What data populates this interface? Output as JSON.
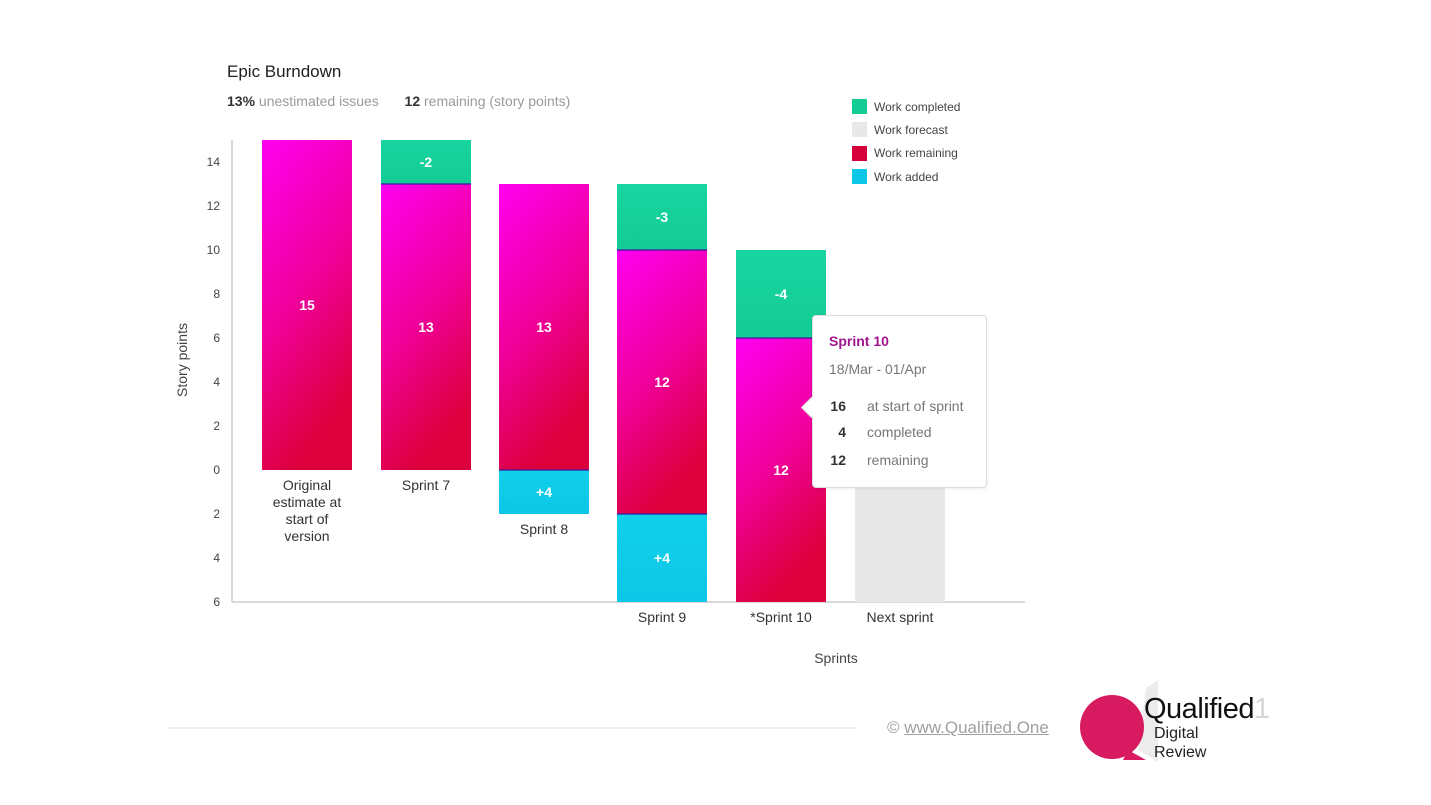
{
  "header": {
    "title": "Epic Burndown",
    "unestimated_pct": "13%",
    "unestimated_label": "unestimated issues",
    "remaining_value": "12",
    "remaining_label": "remaining (story points)"
  },
  "legend": [
    {
      "label": "Work completed",
      "color": "#14cc94"
    },
    {
      "label": "Work forecast",
      "color": "#e8e8e8"
    },
    {
      "label": "Work remaining",
      "color": "#d6003a"
    },
    {
      "label": "Work added",
      "color": "#0ec6e6"
    }
  ],
  "tooltip": {
    "title": "Sprint 10",
    "dates": "18/Mar - 01/Apr",
    "rows": [
      {
        "value": "16",
        "label": "at start of sprint"
      },
      {
        "value": "4",
        "label": "completed"
      },
      {
        "value": "12",
        "label": "remaining"
      }
    ]
  },
  "footer": {
    "copyright_symbol": "©",
    "copyright_link": "www.Qualified.One",
    "logo_main": "Qualified",
    "logo_one": "1",
    "logo_line2": "Digital",
    "logo_line3": "Review"
  },
  "colors": {
    "completed": "#14cc94",
    "forecast": "#e8e8e8",
    "remaining_top": "#ff00f0",
    "remaining_bottom": "#dc003c",
    "added": "#0ec6e6",
    "tooltip_title": "#a0158f",
    "logo_pink": "#d81b60"
  },
  "chart_data": {
    "type": "bar",
    "title": "Epic Burndown",
    "xlabel": "Sprints",
    "ylabel": "Story points",
    "ylim": [
      -6,
      15
    ],
    "yticks": [
      14,
      12,
      10,
      8,
      6,
      4,
      2,
      0,
      -2,
      -4,
      -6
    ],
    "ytick_labels": [
      "14",
      "12",
      "10",
      "8",
      "6",
      "4",
      "2",
      "0",
      "2",
      "4",
      "6"
    ],
    "grid": false,
    "legend_position": "top-right",
    "categories": [
      "Original estimate at start of version",
      "Sprint 7",
      "Sprint 8",
      "Sprint 9",
      "*Sprint 10",
      "Next sprint"
    ],
    "category_label_lines": [
      [
        "Original",
        "estimate at",
        "start of",
        "version"
      ],
      [
        "Sprint 7"
      ],
      [
        "Sprint 8"
      ],
      [
        "Sprint 9"
      ],
      [
        "*Sprint 10"
      ],
      [
        "Next sprint"
      ]
    ],
    "series": [
      {
        "name": "Work completed",
        "values": [
          null,
          -2,
          null,
          -3,
          -4,
          null
        ]
      },
      {
        "name": "Work remaining",
        "values": [
          15,
          13,
          13,
          12,
          12,
          null
        ]
      },
      {
        "name": "Work added",
        "values": [
          null,
          null,
          4,
          4,
          null,
          null
        ]
      },
      {
        "name": "Work forecast",
        "values": [
          null,
          null,
          null,
          null,
          null,
          12
        ]
      }
    ],
    "segments": [
      [
        {
          "series": "remaining",
          "from": 0,
          "to": 15,
          "label": "15"
        }
      ],
      [
        {
          "series": "completed",
          "from": 13,
          "to": 15,
          "label": "-2"
        },
        {
          "series": "remaining",
          "from": 0,
          "to": 13,
          "label": "13"
        }
      ],
      [
        {
          "series": "remaining",
          "from": 0,
          "to": 13,
          "label": "13"
        },
        {
          "series": "added",
          "from": -2,
          "to": 0,
          "label": "+4"
        }
      ],
      [
        {
          "series": "completed",
          "from": 10,
          "to": 13,
          "label": "-3"
        },
        {
          "series": "remaining",
          "from": -2,
          "to": 10,
          "label": "12"
        },
        {
          "series": "added",
          "from": -6,
          "to": -2,
          "label": "+4"
        }
      ],
      [
        {
          "series": "completed",
          "from": 6,
          "to": 10,
          "label": "-4"
        },
        {
          "series": "remaining",
          "from": -6,
          "to": 6,
          "label": "12"
        }
      ],
      [
        {
          "series": "forecast",
          "from": -6,
          "to": 6,
          "label": ""
        }
      ]
    ]
  }
}
